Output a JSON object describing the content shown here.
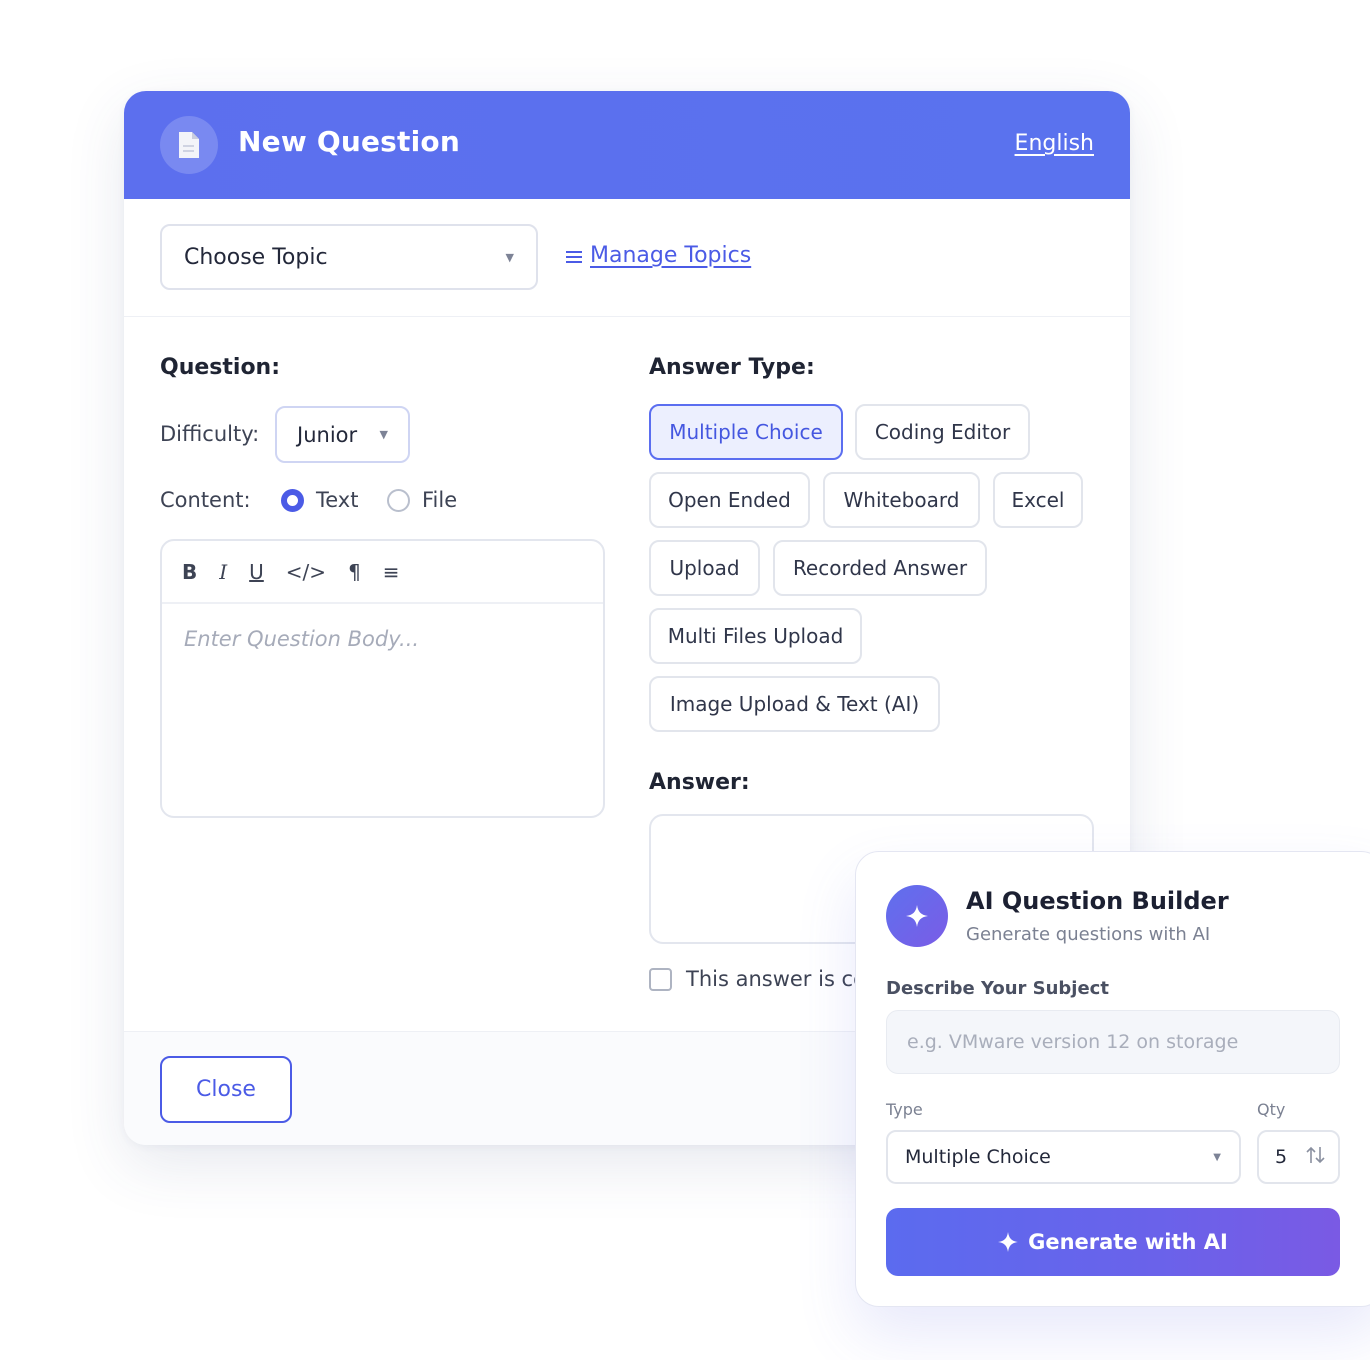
{
  "modal": {
    "title": "New Question",
    "language_link": "English",
    "topic_select_value": "Choose Topic",
    "manage_topics_link": "Manage Topics"
  },
  "question": {
    "heading": "Question:",
    "difficulty_label": "Difficulty:",
    "difficulty_value": "Junior",
    "content_label": "Content:",
    "content_options": [
      "Text",
      "File"
    ],
    "content_selected": "Text",
    "editor_toolbar": [
      "B",
      "I",
      "U",
      "</>",
      "¶",
      "≡"
    ],
    "editor_placeholder": "Enter Question Body..."
  },
  "answer_type": {
    "heading": "Answer Type:",
    "options": [
      "Multiple Choice",
      "Coding Editor",
      "Open Ended",
      "Whiteboard",
      "Excel",
      "Upload",
      "Recorded Answer",
      "Multi Files Upload",
      "Image Upload & Text (AI)"
    ],
    "selected": "Multiple Choice"
  },
  "answer": {
    "heading": "Answer:",
    "checkbox_label": "This answer is co"
  },
  "footer": {
    "close_label": "Close"
  },
  "ai_builder": {
    "title": "AI Question Builder",
    "subtitle": "Generate questions with AI",
    "describe_label": "Describe Your Subject",
    "describe_placeholder": "e.g. VMware version 12 on storage",
    "type_label": "Type",
    "type_value": "Multiple Choice",
    "qty_label": "Qty",
    "qty_value": "5",
    "generate_label": "Generate with AI"
  },
  "colors": {
    "header_blue": "#5c6fee",
    "accent": "#4b5be6",
    "ai_gradient_end": "#7a5ae4"
  }
}
